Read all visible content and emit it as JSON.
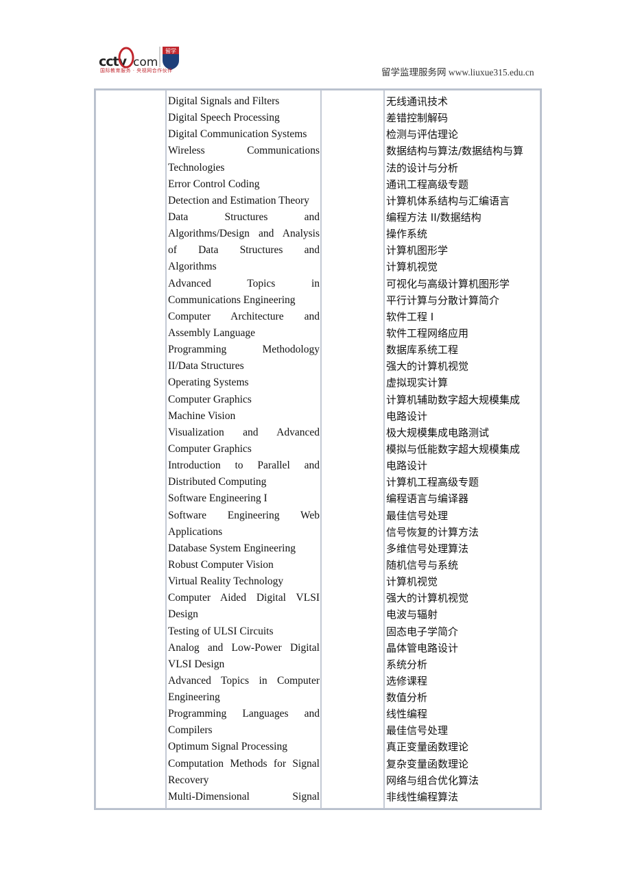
{
  "header": {
    "logo_text": "cctv.com",
    "logo_subtitle": "国际教育服务 · 央视网合作伙伴",
    "badge_text": "留学",
    "site_label": "留学监理服务网 www.liuxue315.edu.cn"
  },
  "table": {
    "english_courses": [
      {
        "text": "Digital Signals and Filters",
        "justify": false
      },
      {
        "text": "Digital Speech Processing",
        "justify": false
      },
      {
        "text": "Digital Communication Systems",
        "justify": false
      },
      {
        "text": "Wireless Communications",
        "justify": true
      },
      {
        "text": "Technologies",
        "justify": false
      },
      {
        "text": "Error Control Coding",
        "justify": false
      },
      {
        "text": "Detection and Estimation Theory",
        "justify": false
      },
      {
        "text": "Data Structures and",
        "justify": true
      },
      {
        "text": "Algorithms/Design and Analysis",
        "justify": true
      },
      {
        "text": "of Data Structures and",
        "justify": true
      },
      {
        "text": "Algorithms",
        "justify": false
      },
      {
        "text": "Advanced Topics in",
        "justify": true
      },
      {
        "text": "Communications Engineering",
        "justify": false
      },
      {
        "text": "Computer Architecture and",
        "justify": true
      },
      {
        "text": "Assembly Language",
        "justify": false
      },
      {
        "text": "Programming Methodology",
        "justify": true
      },
      {
        "text": "II/Data Structures",
        "justify": false
      },
      {
        "text": "Operating Systems",
        "justify": false
      },
      {
        "text": "Computer Graphics",
        "justify": false
      },
      {
        "text": "Machine Vision",
        "justify": false
      },
      {
        "text": "Visualization and Advanced",
        "justify": true
      },
      {
        "text": "Computer Graphics",
        "justify": false
      },
      {
        "text": "Introduction to Parallel and",
        "justify": true
      },
      {
        "text": "Distributed Computing",
        "justify": false
      },
      {
        "text": "Software Engineering I",
        "justify": false
      },
      {
        "text": "Software Engineering Web",
        "justify": true
      },
      {
        "text": "Applications",
        "justify": false
      },
      {
        "text": "Database System Engineering",
        "justify": false
      },
      {
        "text": "Robust Computer Vision",
        "justify": false
      },
      {
        "text": "Virtual Reality Technology",
        "justify": false
      },
      {
        "text": "Computer Aided Digital VLSI",
        "justify": true
      },
      {
        "text": "Design",
        "justify": false
      },
      {
        "text": "Testing of ULSI Circuits",
        "justify": false
      },
      {
        "text": "Analog and Low-Power Digital",
        "justify": true
      },
      {
        "text": "VLSI Design",
        "justify": false
      },
      {
        "text": "Advanced Topics in Computer",
        "justify": true
      },
      {
        "text": "Engineering",
        "justify": false
      },
      {
        "text": "Programming Languages and",
        "justify": true
      },
      {
        "text": "Compilers",
        "justify": false
      },
      {
        "text": "Optimum Signal Processing",
        "justify": false
      },
      {
        "text": "Computation Methods for Signal",
        "justify": true
      },
      {
        "text": "Recovery",
        "justify": false
      },
      {
        "text": "Multi-Dimensional Signal",
        "justify": true
      }
    ],
    "chinese_courses": [
      "无线通讯技术",
      "差错控制解码",
      "检测与评估理论",
      "数据结构与算法/数据结构与算",
      "法的设计与分析",
      "通讯工程高级专题",
      "计算机体系结构与汇编语言",
      "编程方法 II/数据结构",
      "操作系统",
      "计算机图形学",
      "计算机视觉",
      "可视化与高级计算机图形学",
      "平行计算与分散计算简介",
      "软件工程 I",
      "软件工程网络应用",
      "数据库系统工程",
      "强大的计算机视觉",
      "虚拟现实计算",
      "计算机辅助数字超大规模集成",
      "电路设计",
      "极大规模集成电路测试",
      "模拟与低能数字超大规模集成",
      "电路设计",
      "计算机工程高级专题",
      "编程语言与编译器",
      "最佳信号处理",
      "信号恢复的计算方法",
      "多维信号处理算法",
      "随机信号与系统",
      "计算机视觉",
      "强大的计算机视觉",
      "电波与辐射",
      "固态电子学简介",
      "晶体管电路设计",
      "系统分析",
      "选修课程",
      "数值分析",
      "线性编程",
      "最佳信号处理",
      "真正变量函数理论",
      "复杂变量函数理论",
      "网络与组合优化算法",
      "非线性编程算法"
    ]
  }
}
